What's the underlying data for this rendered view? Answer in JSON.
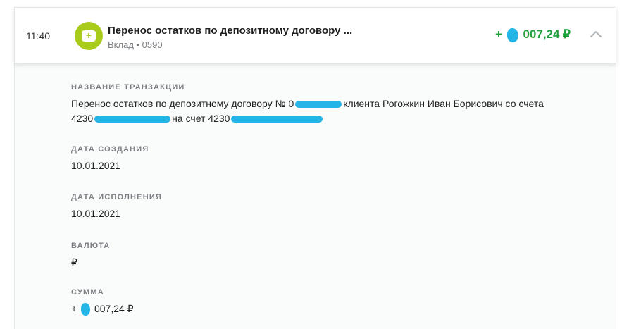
{
  "header": {
    "time": "11:40",
    "title": "Перенос остатков по депозитному договору ...",
    "subtitle": "Вклад • 0590",
    "amount_prefix": "+",
    "amount_suffix": "007,24 ₽",
    "icons": {
      "category": "plus-card-icon",
      "collapse": "chevron-up-icon"
    },
    "colors": {
      "amount": "#21a038",
      "category_icon": "#a9cc1b",
      "redaction": "#22b5e6"
    }
  },
  "details": {
    "name": {
      "label": "НАЗВАНИЕ ТРАНЗАКЦИИ",
      "line1_a": "Перенос остатков по депозитному договору № 0",
      "line1_b": "клиента Рогожкин Иван Борисович со счета",
      "line2_a": "4230",
      "line2_b": "на счет 4230"
    },
    "created": {
      "label": "ДАТА СОЗДАНИЯ",
      "value": "10.01.2021"
    },
    "executed": {
      "label": "ДАТА ИСПОЛНЕНИЯ",
      "value": "10.01.2021"
    },
    "currency": {
      "label": "ВАЛЮТА",
      "value": "₽"
    },
    "sum": {
      "label": "СУММА",
      "prefix": "+",
      "suffix": "007,24 ₽"
    }
  }
}
